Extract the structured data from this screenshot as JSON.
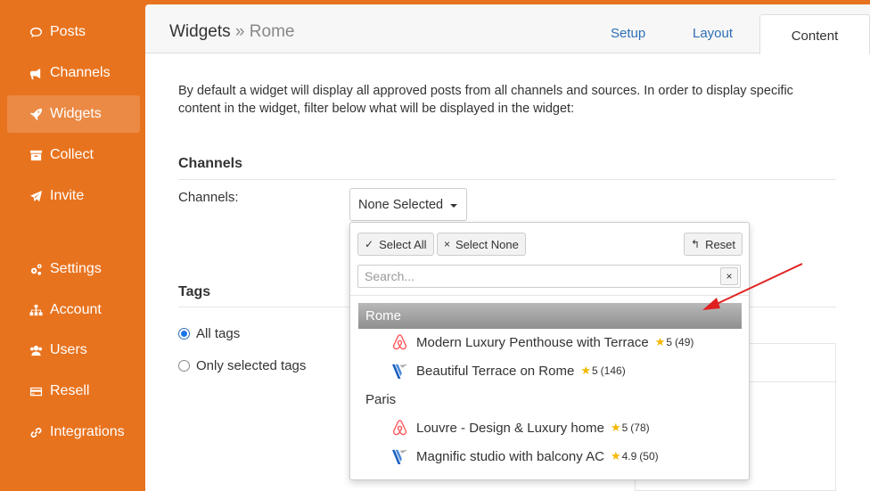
{
  "colors": {
    "sidebar": "#e8731e",
    "active": "#eb8a45",
    "link": "#2d6fb5",
    "star": "#f5b800",
    "arrow": "#e02020"
  },
  "sidebar": {
    "items": [
      {
        "label": "Posts",
        "icon": "comment-icon"
      },
      {
        "label": "Channels",
        "icon": "megaphone-icon"
      },
      {
        "label": "Widgets",
        "icon": "rocket-icon",
        "active": true
      },
      {
        "label": "Collect",
        "icon": "archive-icon"
      },
      {
        "label": "Invite",
        "icon": "paper-plane-icon"
      },
      {
        "label": "Settings",
        "icon": "gears-icon"
      },
      {
        "label": "Account",
        "icon": "sitemap-icon"
      },
      {
        "label": "Users",
        "icon": "users-icon"
      },
      {
        "label": "Resell",
        "icon": "credit-card-icon"
      },
      {
        "label": "Integrations",
        "icon": "link-icon"
      }
    ]
  },
  "header": {
    "breadcrumb_root": "Widgets",
    "breadcrumb_sep": "»",
    "breadcrumb_current": "Rome",
    "tabs": {
      "setup": "Setup",
      "layout": "Layout",
      "content": "Content"
    }
  },
  "content": {
    "intro": "By default a widget will display all approved posts from all channels and sources. In order to display specific content in the widget, filter below what will be displayed in the widget:",
    "channels_title": "Channels",
    "channels_label": "Channels:",
    "channels_selected": "None Selected",
    "tags_title": "Tags",
    "tags_options": [
      "All tags",
      "Only selected tags"
    ]
  },
  "dropdown": {
    "select_all": "Select All",
    "select_none": "Select None",
    "reset": "Reset",
    "search_placeholder": "Search...",
    "clear": "×",
    "groups": [
      {
        "name": "Rome",
        "items": [
          {
            "title": "Modern Luxury Penthouse with Terrace",
            "source": "airbnb-icon",
            "stars": "5",
            "count": "(49)"
          },
          {
            "title": "Beautiful Terrace on Rome",
            "source": "vrbo-icon",
            "stars": "5",
            "count": "(146)"
          }
        ]
      },
      {
        "name": "Paris",
        "items": [
          {
            "title": "Louvre - Design & Luxury home",
            "source": "airbnb-icon",
            "stars": "5",
            "count": "(78)"
          },
          {
            "title": "Magnific studio with balcony AC",
            "source": "vrbo-icon",
            "stars": "4.9",
            "count": "(50)"
          }
        ]
      }
    ]
  }
}
